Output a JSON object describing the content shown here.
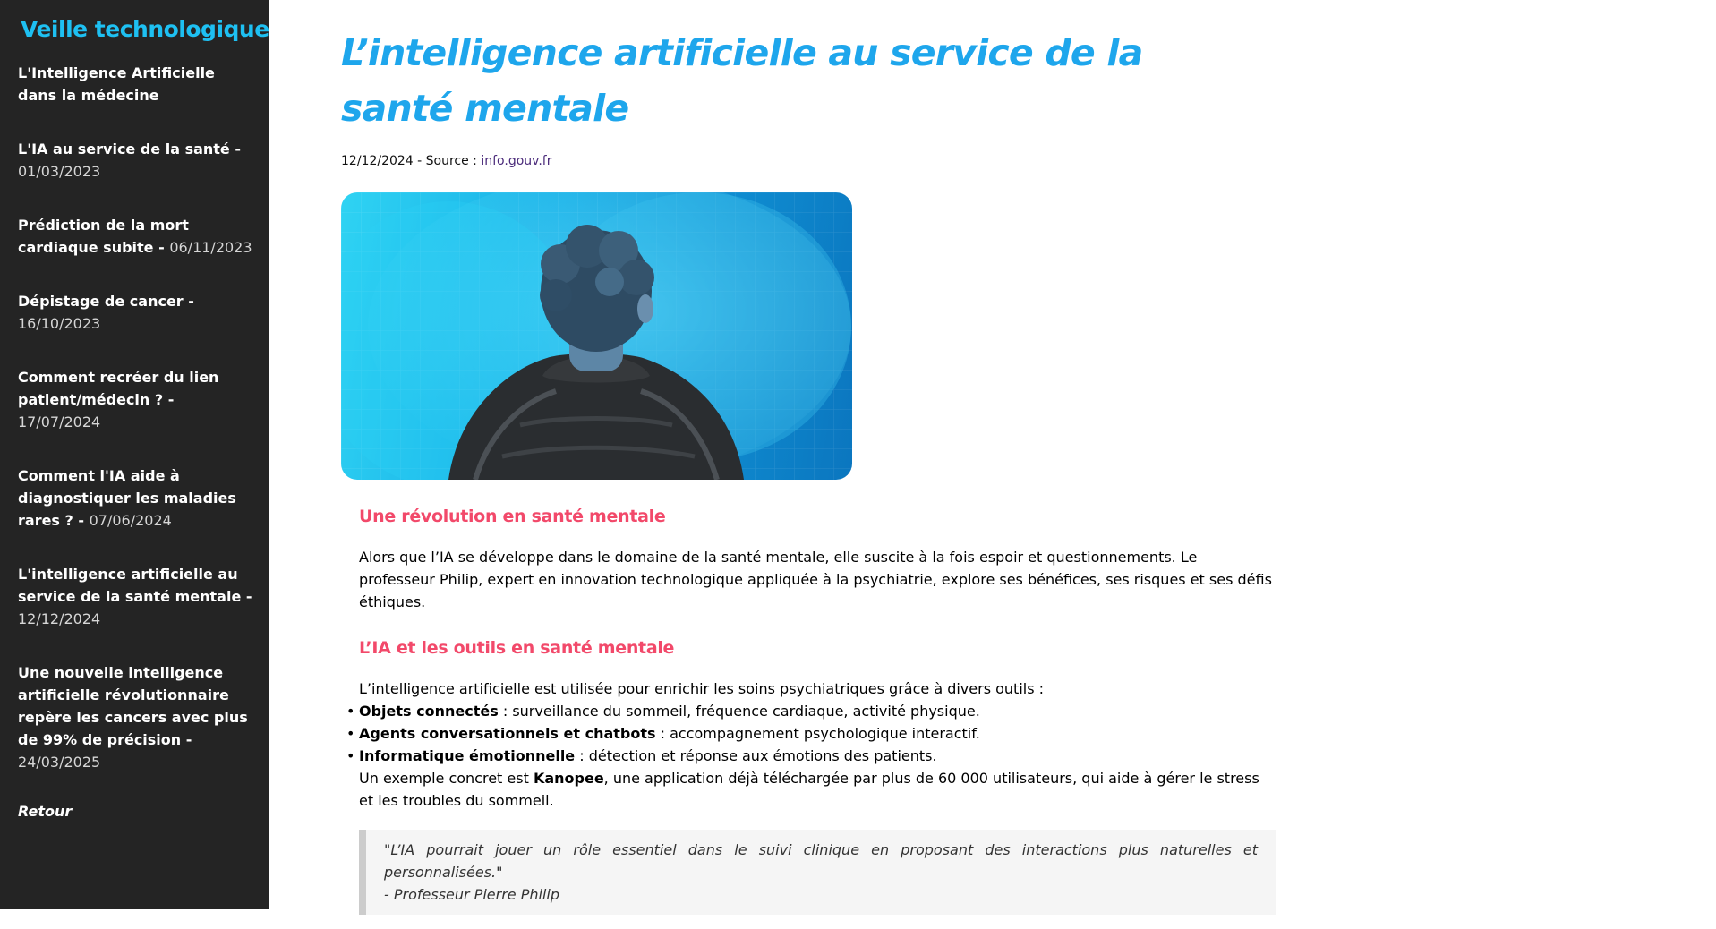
{
  "sidebar": {
    "title": "Veille technologique",
    "items": [
      {
        "label": "L'Intelligence Artificielle dans la médecine",
        "date": ""
      },
      {
        "label": "L'IA au service de la santé - ",
        "date": "01/03/2023"
      },
      {
        "label": "Prédiction de la mort cardiaque subite - ",
        "date": "06/11/2023"
      },
      {
        "label": "Dépistage de cancer - ",
        "date": "16/10/2023"
      },
      {
        "label": "Comment recréer du lien patient/médecin ? - ",
        "date": "17/07/2024"
      },
      {
        "label": "Comment l'IA aide à diagnostiquer les maladies rares ? - ",
        "date": "07/06/2024"
      },
      {
        "label": "L'intelligence artificielle au service de la santé mentale - ",
        "date": "12/12/2024"
      },
      {
        "label": "Une nouvelle intelligence artificielle révolutionnaire repère les cancers avec plus de 99% de précision - ",
        "date": "24/03/2025"
      }
    ],
    "back_label": "Retour"
  },
  "article": {
    "title": "L’intelligence artificielle au service de la santé mentale",
    "meta_prefix": "12/12/2024 - Source : ",
    "source_link": "info.gouv.fr",
    "section1_title": "Une révolution en santé mentale",
    "section1_text": "Alors que l’IA se développe dans le domaine de la santé mentale, elle suscite à la fois espoir et questionnements. Le professeur Philip, expert en innovation technologique appliquée à la psychiatrie, explore ses bénéfices, ses risques et ses défis éthiques.",
    "section2_title": "L’IA et les outils en santé mentale",
    "section2_intro": "L’intelligence artificielle est utilisée pour enrichir les soins psychiatriques grâce à divers outils :",
    "tools": [
      {
        "name": "Objets connectés",
        "desc": " : surveillance du sommeil, fréquence cardiaque, activité physique."
      },
      {
        "name": "Agents conversationnels et chatbots",
        "desc": " : accompagnement psychologique interactif."
      },
      {
        "name": "Informatique émotionnelle",
        "desc": " : détection et réponse aux émotions des patients."
      }
    ],
    "example_prefix": "Un exemple concret est ",
    "example_name": "Kanopee",
    "example_suffix": ", une application déjà téléchargée par plus de 60 000 utilisateurs, qui aide à gérer le stress et les troubles du sommeil.",
    "quote_text": "\"L’IA pourrait jouer un rôle essentiel dans le suivi clinique en proposant des interactions plus naturelles et personnalisées.\"",
    "quote_author": "- Professeur Pierre Philip"
  },
  "colors": {
    "sidebar_bg": "#242424",
    "sidebar_title": "#1ec0f2",
    "title_blue": "#1ea6ec",
    "section_red": "#f2496a"
  }
}
